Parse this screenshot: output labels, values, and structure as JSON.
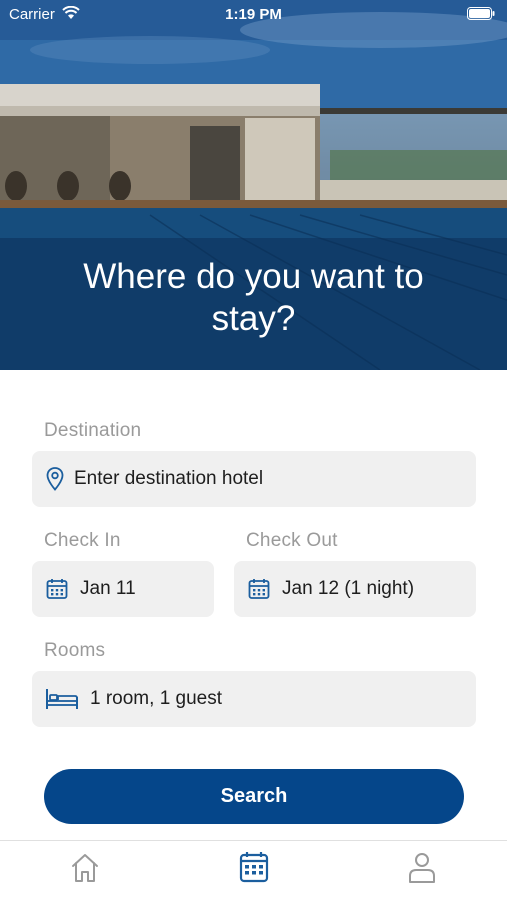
{
  "status_bar": {
    "carrier": "Carrier",
    "time": "1:19 PM"
  },
  "hero": {
    "title": "Where do you want to stay?"
  },
  "form": {
    "destination_label": "Destination",
    "destination_placeholder": "Enter destination hotel",
    "checkin_label": "Check In",
    "checkin_value": "Jan 11",
    "checkout_label": "Check Out",
    "checkout_value": "Jan 12 (1 night)",
    "rooms_label": "Rooms",
    "rooms_value": "1 room, 1 guest",
    "search_label": "Search"
  },
  "tabbar": {
    "tabs": [
      {
        "icon": "home-icon",
        "active": false
      },
      {
        "icon": "calendar-icon",
        "active": true
      },
      {
        "icon": "profile-icon",
        "active": false
      }
    ]
  },
  "colors": {
    "accent": "#05468a",
    "icon_blue": "#1b5e9e",
    "inactive_icon": "#9a9a9a",
    "field_bg": "#f0f0f0",
    "label_gray": "#9a9a9a"
  }
}
